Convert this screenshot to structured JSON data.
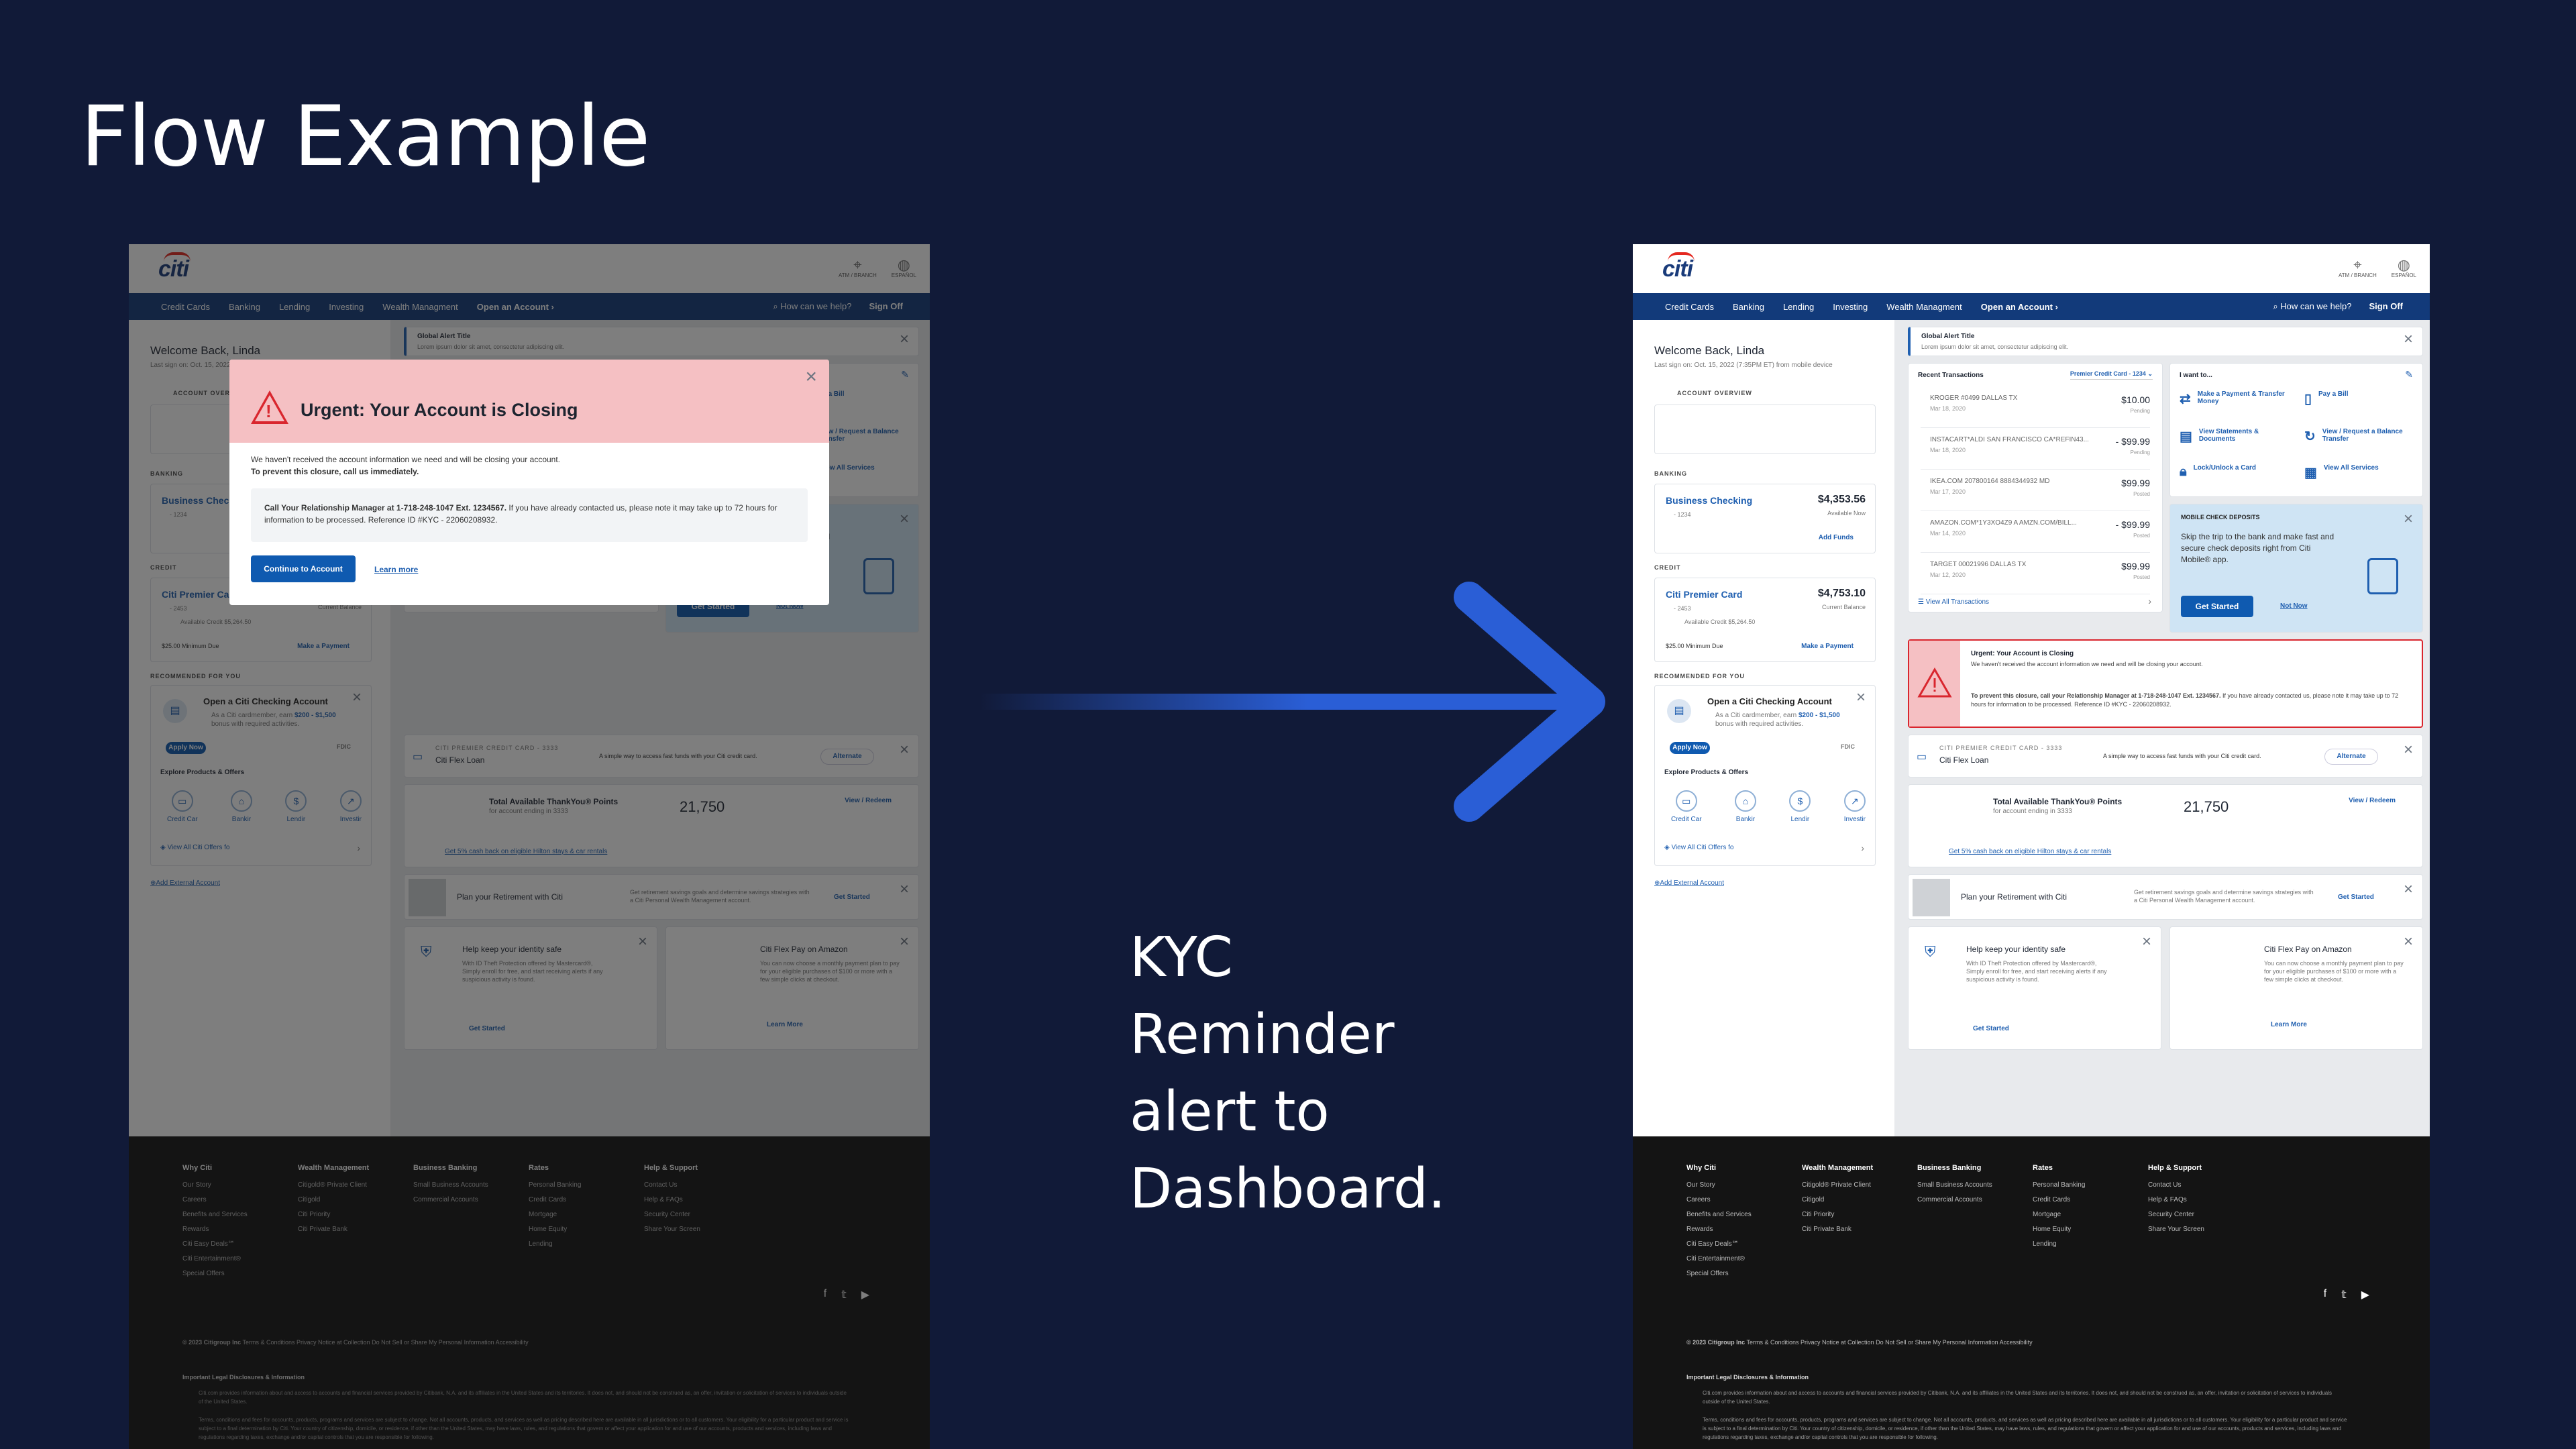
{
  "page": {
    "heading": "Flow Example",
    "caption_lines": [
      "KYC",
      "Reminder",
      "alert to",
      "Dashboard."
    ]
  },
  "colors": {
    "background": "#111a38",
    "arrow": "#2a5ed6",
    "nav": "#123a7a",
    "alert_red": "#d9262e",
    "modal_pink": "#f5c0c3",
    "link_blue": "#1f5fb0",
    "mobile_card": "#cfe4f4"
  },
  "screen": {
    "logo": "citi",
    "utilities": [
      {
        "icon": "location-pin-icon",
        "label": "ATM / BRANCH"
      },
      {
        "icon": "globe-icon",
        "label": "ESPAÑOL"
      }
    ],
    "nav": [
      "Credit Cards",
      "Banking",
      "Lending",
      "Investing",
      "Wealth Managment",
      "Open an Account"
    ],
    "help": "How can we help?",
    "sign_off": "Sign Off",
    "welcome": "Welcome Back, Linda",
    "last_signon": "Last sign on: Oct. 15, 2022 (7:35PM ET) from mobile device",
    "account_overview": "ACCOUNT OVERVIEW",
    "banking_label": "BANKING",
    "banking": {
      "name": "Business Checking",
      "num": "- 1234",
      "amount": "$4,353.56",
      "sub": "Available Now",
      "link": "Add Funds"
    },
    "credit_label": "CREDIT",
    "credit": {
      "name": "Citi Premier Card",
      "num": "- 2453",
      "amount": "$4,753.10",
      "sub": "Current Balance",
      "avail": "Available Credit $5,264.50",
      "min": "$25.00 Minimum Due",
      "link": "Make a Payment"
    },
    "recommended_label": "RECOMMENDED FOR YOU",
    "rec": {
      "title": "Open a Citi Checking Account",
      "body_1": "As a Citi cardmember, earn",
      "bonus": "$200 - $1,500",
      "body_2": "bonus with required activities.",
      "cta": "Apply Now",
      "fdic": "FDIC"
    },
    "explore": {
      "title": "Explore Products & Offers",
      "items": [
        "Credit Car",
        "Bankir",
        "Lendir",
        "Investir"
      ],
      "view_all": "View All Citi Offers fo"
    },
    "add_external": "Add External Account",
    "global_alert": {
      "title": "Global Alert Title",
      "body": "Lorem ipsum dolor sit amet, consectetur adipiscing elit."
    },
    "recent": {
      "title": "Recent Transactions",
      "selector": "Premier Credit Card - 1234",
      "rows": [
        {
          "desc": "KROGER #0499 DALLAS TX",
          "date": "Mar 18, 2020",
          "amount": "$10.00",
          "status": "Pending"
        },
        {
          "desc": "INSTACART*ALDI SAN FRANCISCO CA*REFIN43...",
          "date": "Mar 18, 2020",
          "amount": "- $99.99",
          "status": "Pending"
        },
        {
          "desc": "IKEA.COM 207800164 8884344932 MD",
          "date": "Mar 17, 2020",
          "amount": "$99.99",
          "status": "Posted"
        },
        {
          "desc": "AMAZON.COM*1Y3XO4Z9 A AMZN.COM/BILL...",
          "date": "Mar 14, 2020",
          "amount": "- $99.99",
          "status": "Posted"
        },
        {
          "desc": "TARGET 00021996 DALLAS TX",
          "date": "Mar 12, 2020",
          "amount": "$99.99",
          "status": "Posted"
        }
      ],
      "view_all": "View All Transactions"
    },
    "iwant": {
      "title": "I want to...",
      "items": [
        {
          "icon": "transfer-icon",
          "label": "Make a Payment & Transfer Money"
        },
        {
          "icon": "bill-icon",
          "label": "Pay a Bill"
        },
        {
          "icon": "statement-icon",
          "label": "View Statements & Documents"
        },
        {
          "icon": "refresh-icon",
          "label": "View / Request a Balance Transfer"
        },
        {
          "icon": "lock-icon",
          "label": "Lock/Unlock a Card"
        },
        {
          "icon": "grid-icon",
          "label": "View All Services"
        }
      ]
    },
    "mobile": {
      "title": "MOBILE CHECK DEPOSITS",
      "body": "Skip the trip to the bank and make fast and secure check deposits right from Citi Mobile® app.",
      "cta": "Get Started",
      "alt": "Not Now"
    },
    "kyc_alert": {
      "title": "Urgent: Your Account is Closing",
      "line1": "We haven't received the account information we need and will be closing your account.",
      "line2_bold": "To prevent this closure, call your Relationship Manager at 1-718-248-1047 Ext. 1234567.",
      "line2_rest": "If you have already contacted us, please note it may take up to 72 hours for information to be processed. Reference ID #KYC - 22060208932."
    },
    "flexloan": {
      "eyebrow": "CITI PREMIER CREDIT CARD - 3333",
      "title": "Citi Flex Loan",
      "body": "A simple way to access fast funds with your Citi credit card.",
      "cta": "Alternate"
    },
    "thankyou": {
      "title": "Total Available ThankYou® Points",
      "sub": "for account ending in 3333",
      "points": "21,750",
      "link": "View / Redeem",
      "promo": "Get 5% cash back on eligible Hilton stays & car rentals"
    },
    "retire": {
      "title": "Plan your Retirement with Citi",
      "body": "Get retirement savings goals and determine savings strategies with a Citi Personal Wealth Management account.",
      "cta": "Get Started"
    },
    "identity": {
      "title": "Help keep your identity safe",
      "body": "With ID Theft Protection offered by Mastercard®, Simply enroll for free, and start receiving alerts if any suspicious activity is found.",
      "cta": "Get Started"
    },
    "flexpay": {
      "title": "Citi Flex Pay on Amazon",
      "body": "You can now choose a monthly payment plan to pay for your eligible purchases of $100 or more with a few simple clicks at checkout.",
      "cta": "Learn More"
    },
    "footer": {
      "cols": [
        {
          "title": "Why Citi",
          "items": [
            "Our Story",
            "Careers",
            "Benefits and Services",
            "Rewards",
            "Citi Easy Deals℠",
            "Citi Entertainment®",
            "Special Offers"
          ]
        },
        {
          "title": "Wealth Management",
          "items": [
            "Citigold® Private Client",
            "Citigold",
            "Citi Priority",
            "Citi Private Bank"
          ]
        },
        {
          "title": "Business Banking",
          "items": [
            "Small Business Accounts",
            "Commercial Accounts"
          ]
        },
        {
          "title": "Rates",
          "items": [
            "Personal Banking",
            "Credit Cards",
            "Mortgage",
            "Home Equity",
            "Lending"
          ]
        },
        {
          "title": "Help & Support",
          "items": [
            "Contact Us",
            "Help & FAQs",
            "Security Center",
            "Share Your Screen"
          ]
        }
      ],
      "social": [
        "facebook-icon",
        "twitter-icon",
        "youtube-icon"
      ],
      "copyright": "© 2023 Citigroup Inc",
      "links": "Terms & Conditions  Privacy   Notice at Collection  Do Not Sell or Share My Personal Information  Accessibility",
      "legal_title": "Important Legal Disclosures & Information",
      "legal_1": "Citi.com provides information about and access to accounts and financial services provided by Citibank, N.A. and its affiliates in the United States and its territories. It does not, and should not be construed as, an offer, invitation or solicitation of services to individuals outside of the United States.",
      "legal_2": "Terms, conditions and fees for accounts, products, programs and services are subject to change. Not all accounts, products, and services as well as pricing described here are available in all jurisdictions or to all customers. Your eligibility for a particular product and service is subject to a final determination by Citi. Your country of citizenship, domicile, or residence, if other than the United States, may have laws, rules, and regulations that govern or affect your application for and use of our accounts, products and services, including laws and regulations regarding taxes, exchange and/or capital controls that you are responsible for following."
    }
  },
  "modal": {
    "title": "Urgent: Your Account is Closing",
    "line1": "We haven't received the account information we need and will be closing your account.",
    "line2": "To prevent this closure, call us immediately.",
    "box_bold": "Call Your Relationship Manager at 1-718-248-1047 Ext. 1234567.",
    "box_rest": "If you have already contacted us, please note it may take up to 72 hours for information to be processed. Reference ID #KYC - 22060208932.",
    "primary": "Continue to Account",
    "secondary": "Learn more"
  }
}
